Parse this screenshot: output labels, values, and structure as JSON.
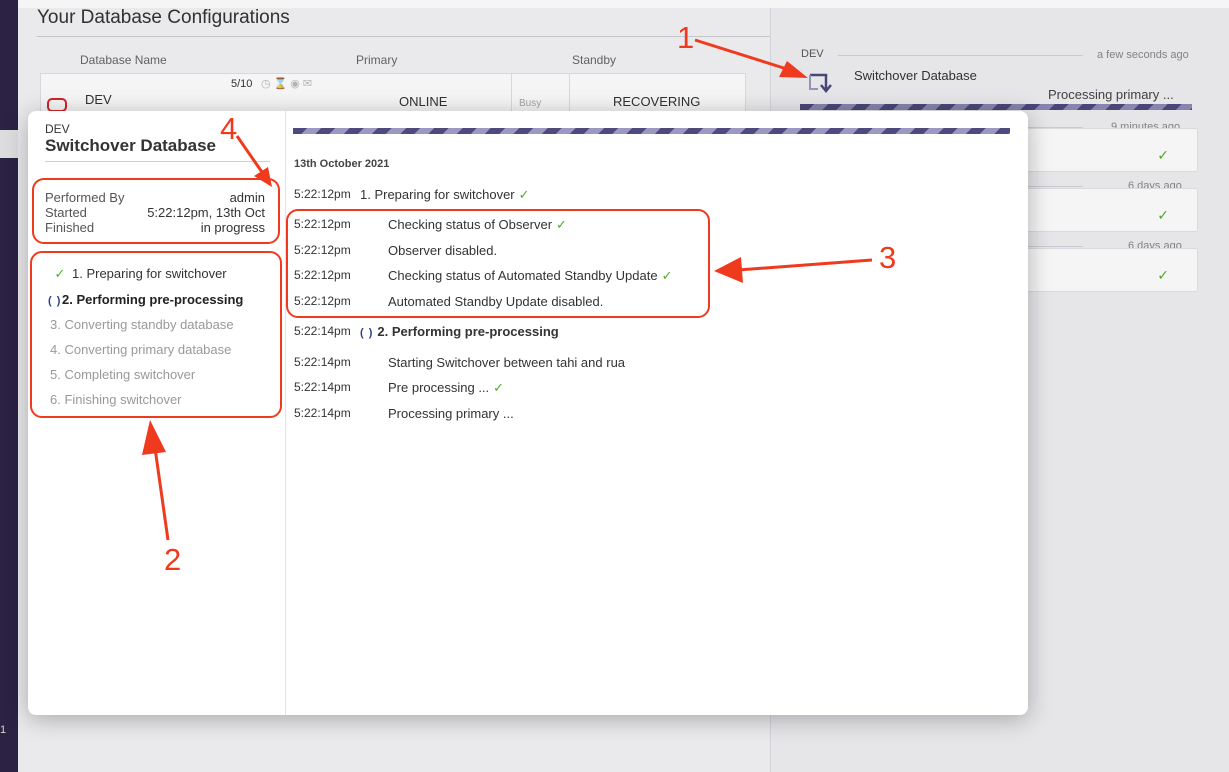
{
  "background": {
    "title": "Your Database Configurations",
    "columns": {
      "name": "Database Name",
      "primary": "Primary",
      "standby": "Standby"
    },
    "row": {
      "name": "DEV",
      "count": "5/10",
      "primary_status": "ONLINE",
      "busy": "Busy",
      "standby_status": "RECOVERING"
    },
    "rail_num": "1"
  },
  "activity": {
    "current": {
      "label": "DEV",
      "time": "a few seconds ago",
      "title": "Switchover Database",
      "status": "Processing primary ..."
    },
    "history": [
      {
        "time": "9 minutes ago"
      },
      {
        "time": "6 days ago"
      },
      {
        "time": "6 days ago"
      }
    ]
  },
  "modal": {
    "db_label": "DEV",
    "title": "Switchover Database",
    "info": {
      "performed_by_label": "Performed By",
      "performed_by": "admin",
      "started_label": "Started",
      "started": "5:22:12pm, 13th Oct",
      "finished_label": "Finished",
      "finished": "in progress"
    },
    "steps": [
      {
        "label": "1. Preparing for switchover",
        "state": "done"
      },
      {
        "label": "2. Performing pre-processing",
        "state": "active"
      },
      {
        "label": "3. Converting standby database",
        "state": "pending"
      },
      {
        "label": "4. Converting primary database",
        "state": "pending"
      },
      {
        "label": "5. Completing switchover",
        "state": "pending"
      },
      {
        "label": "6. Finishing switchover",
        "state": "pending"
      }
    ],
    "log_date": "13th October 2021",
    "log": [
      {
        "time": "5:22:12pm",
        "text": "1. Preparing for switchover"
      },
      {
        "time": "5:22:12pm",
        "text": "Checking status of Observer"
      },
      {
        "time": "5:22:12pm",
        "text": "Observer disabled."
      },
      {
        "time": "5:22:12pm",
        "text": "Checking status of Automated Standby Update"
      },
      {
        "time": "5:22:12pm",
        "text": "Automated Standby Update disabled."
      },
      {
        "time": "5:22:14pm",
        "text": "2. Performing pre-processing"
      },
      {
        "time": "5:22:14pm",
        "text": "Starting Switchover between tahi and rua"
      },
      {
        "time": "5:22:14pm",
        "text": "Pre processing ..."
      },
      {
        "time": "5:22:14pm",
        "text": "Processing primary ..."
      }
    ]
  },
  "annotations": {
    "n1": "1",
    "n2": "2",
    "n3": "3",
    "n4": "4"
  },
  "colors": {
    "accent": "#4d4a7d",
    "check": "#4caf26",
    "annotation": "#f03a1e",
    "alert": "#d9262c"
  },
  "icons": {
    "check": "check-icon",
    "spinner": "spinner-icon",
    "switchover": "switchover-icon",
    "database": "database-icon",
    "arrow": "arrow-icon"
  }
}
